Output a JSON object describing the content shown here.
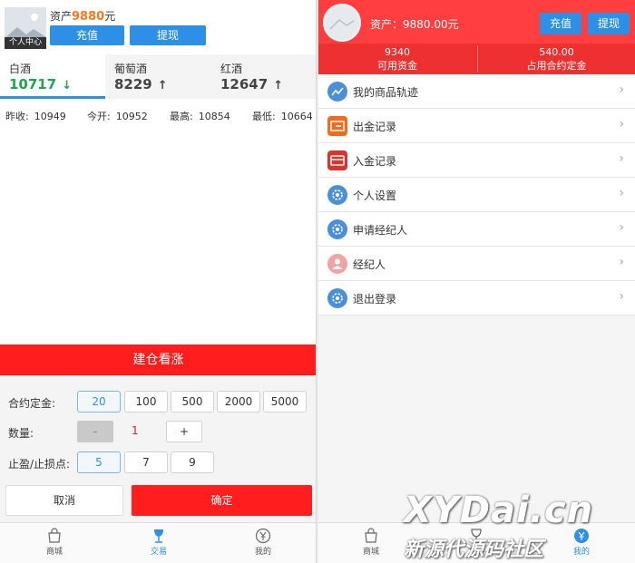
{
  "left": {
    "avatar_caption": "个人中心",
    "asset_prefix": "资产",
    "asset_value": "9880",
    "asset_unit": "元",
    "recharge": "充值",
    "withdraw": "提现",
    "tabs": [
      {
        "name": "白酒",
        "price": "10717",
        "dir": "down"
      },
      {
        "name": "葡萄酒",
        "price": "8229",
        "dir": "up"
      },
      {
        "name": "红酒",
        "price": "12647",
        "dir": "up"
      }
    ],
    "stats": [
      {
        "label": "昨收:",
        "value": "10949"
      },
      {
        "label": "今开:",
        "value": "10952"
      },
      {
        "label": "最高:",
        "value": "10854"
      },
      {
        "label": "最低:",
        "value": "10664"
      }
    ],
    "buy_up": "建仓看涨",
    "deposit_label": "合约定金:",
    "deposit_options": [
      "20",
      "100",
      "500",
      "2000",
      "5000"
    ],
    "quantity_label": "数量:",
    "quantity_minus": "-",
    "quantity_value": "1",
    "quantity_plus": "+",
    "sltp_label": "止盈/止损点:",
    "sltp_options": [
      "5",
      "7",
      "9"
    ],
    "cancel": "取消",
    "confirm": "确定",
    "nav": [
      "商城",
      "交易",
      "我的"
    ]
  },
  "right": {
    "asset": "资产：9880.00元",
    "recharge": "充值",
    "withdraw": "提现",
    "available_value": "9340",
    "available_label": "可用资金",
    "margin_value": "540.00",
    "margin_label": "占用合约定金",
    "menu": [
      "我的商品轨迹",
      "出金记录",
      "入金记录",
      "个人设置",
      "申请经纪人",
      "经纪人",
      "退出登录"
    ],
    "nav": [
      "商城",
      "交易",
      "我的"
    ]
  },
  "watermark": {
    "line1": "XYDai.cn",
    "line2": "新源代源码社区"
  },
  "colors": {
    "accent": "#2e8fe6",
    "red": "#ff1d1d",
    "green": "#1aa94a",
    "orange": "#f47920"
  },
  "icons": {
    "down": "↓",
    "up": "↑"
  }
}
